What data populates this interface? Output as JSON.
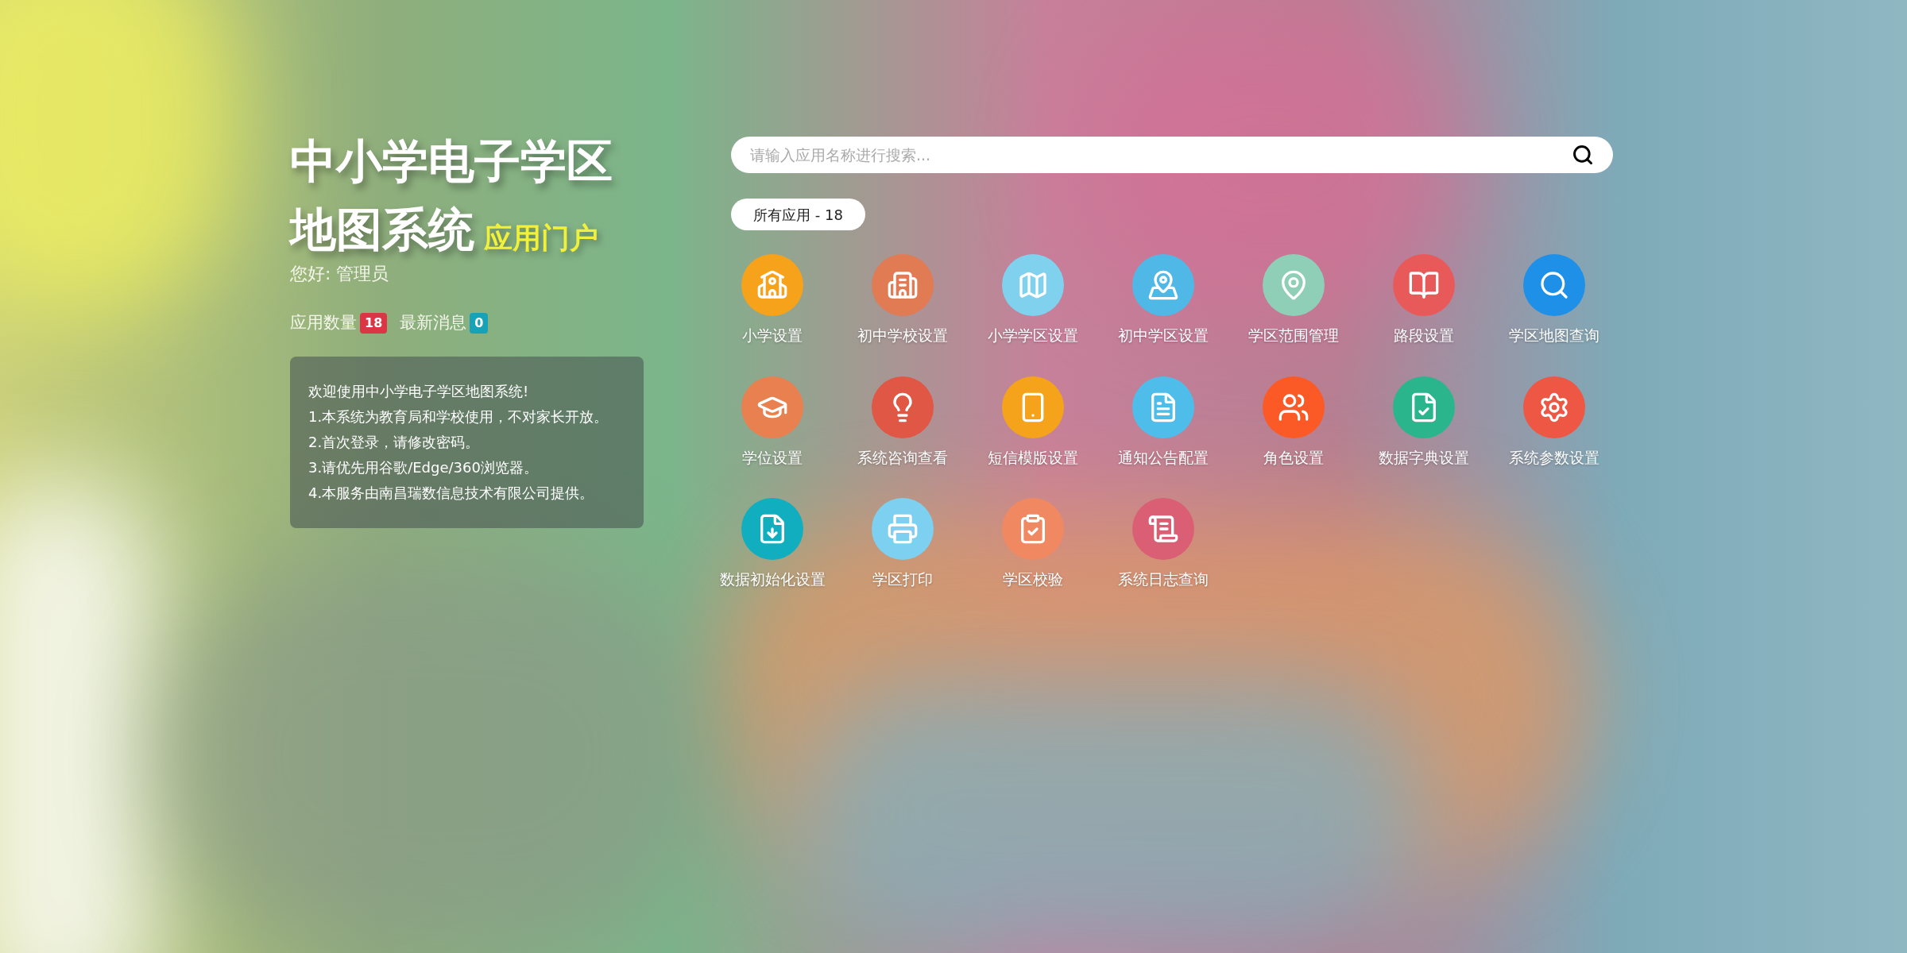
{
  "title": {
    "line1": "中小学电子学区",
    "line2": "地图系统",
    "subtitle": "应用门户"
  },
  "greeting": "您好: 管理员",
  "stats": [
    {
      "label": "应用数量",
      "count": "18",
      "color": "#dc3545"
    },
    {
      "label": "最新消息",
      "count": "0",
      "color": "#17a2b8"
    }
  ],
  "notice": [
    "欢迎使用中小学电子学区地图系统!",
    "1.本系统为教育局和学校使用，不对家长开放。",
    "2.首次登录，请修改密码。",
    "3.请优先用谷歌/Edge/360浏览器。",
    "4.本服务由南昌瑞数信息技术有限公司提供。"
  ],
  "search": {
    "placeholder": "请输入应用名称进行搜索..."
  },
  "filter": {
    "label": "所有应用 - 18"
  },
  "apps": [
    {
      "label": "小学设置",
      "color": "#f7a21b"
    },
    {
      "label": "初中学校设置",
      "color": "#e07b53"
    },
    {
      "label": "小学学区设置",
      "color": "#7fd1ee"
    },
    {
      "label": "初中学区设置",
      "color": "#4fb8e6"
    },
    {
      "label": "学区范围管理",
      "color": "#8fcfb8"
    },
    {
      "label": "路段设置",
      "color": "#e85a5a"
    },
    {
      "label": "学区地图查询",
      "color": "#1e90e8"
    },
    {
      "label": "学位设置",
      "color": "#e8804f"
    },
    {
      "label": "系统咨询查看",
      "color": "#e05845"
    },
    {
      "label": "短信模版设置",
      "color": "#f5a31a"
    },
    {
      "label": "通知公告配置",
      "color": "#4fbde9"
    },
    {
      "label": "角色设置",
      "color": "#fb5a26"
    },
    {
      "label": "数据字典设置",
      "color": "#2bb58d"
    },
    {
      "label": "系统参数设置",
      "color": "#ee5744"
    },
    {
      "label": "数据初始化设置",
      "color": "#10aebf"
    },
    {
      "label": "学区打印",
      "color": "#7dd0ef"
    },
    {
      "label": "学区校验",
      "color": "#f08962"
    },
    {
      "label": "系统日志查询",
      "color": "#db5f74"
    }
  ]
}
